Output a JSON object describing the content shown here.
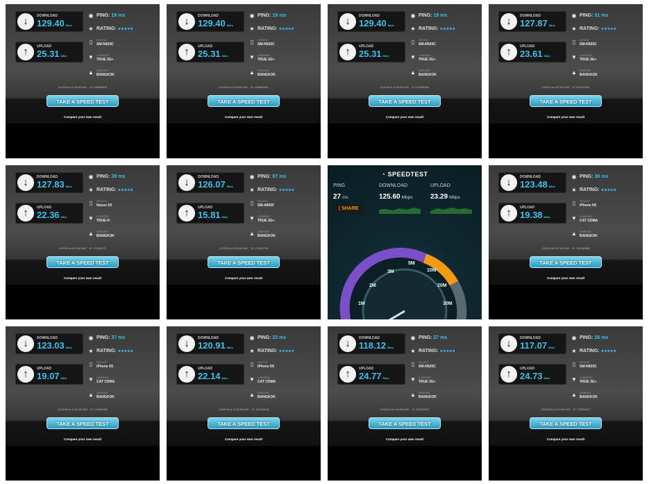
{
  "cards": [
    {
      "download": "129.40",
      "upload": "25.31",
      "ping": "19",
      "device": "SM-N920C",
      "carrier": "TRUE 3G+",
      "server": "BANGKOK",
      "date": "1/4/2016 at 11:06 AM GMT",
      "id": "1088604634"
    },
    {
      "download": "129.40",
      "upload": "25.31",
      "ping": "19",
      "device": "SM-N920C",
      "carrier": "TRUE 3G+",
      "server": "BANGKOK",
      "date": "1/4/2016 at 11:06 AM GMT",
      "id": "1088604634"
    },
    {
      "download": "129.40",
      "upload": "25.31",
      "ping": "19",
      "device": "SM-N920C",
      "carrier": "TRUE 3G+",
      "server": "BANGKOK",
      "date": "1/4/2016 at 11:06 AM GMT",
      "id": "1022069382"
    },
    {
      "download": "127.87",
      "upload": "23.61",
      "ping": "31",
      "device": "SM-N920C",
      "carrier": "TRUE 3G+",
      "server": "BANGKOK",
      "date": "2/4/2016 at 3:23 PM GMT",
      "id": "5740370967"
    },
    {
      "download": "127.83",
      "upload": "22.36",
      "ping": "39",
      "device": "Nexus 5X",
      "carrier": "TRUE-H",
      "server": "BANGKOK",
      "date": "2/2/2016 at 6:01 AM GMT",
      "id": "1714824772"
    },
    {
      "download": "126.07",
      "upload": "15.81",
      "ping": "87",
      "device": "SM-A800F",
      "carrier": "TRUE 3G+",
      "server": "BANGKOK",
      "date": "1/27/2016 at 8:08 AM GMT",
      "id": "1702047758"
    },
    null,
    {
      "download": "123.48",
      "upload": "19.38",
      "ping": "38",
      "device": "iPhone 6S",
      "carrier": "CAT CDMA",
      "server": "BANGKOK",
      "date": "2/3/2016 at 3:07 AM GMT",
      "id": "1021963698"
    },
    {
      "download": "123.03",
      "upload": "19.07",
      "ping": "37",
      "device": "iPhone 6S",
      "carrier": "CAT CDMA",
      "server": "BANGKOK",
      "date": "1/20/2016 at 11:32 AM GMT",
      "id": "1023560390"
    },
    {
      "download": "120.91",
      "upload": "22.14",
      "ping": "23",
      "device": "iPhone 6S",
      "carrier": "CAT CDMA",
      "server": "BANGKOK",
      "date": "1/18/2016 at 10:03 PM GMT",
      "id": "1811826148"
    },
    {
      "download": "118.12",
      "upload": "24.77",
      "ping": "27",
      "device": "SM-N920C",
      "carrier": "TRUE 3G+",
      "server": "BANGKOK",
      "date": "1/15/2016 at 1:40 PM GMT",
      "id": "1679153577"
    },
    {
      "download": "117.07",
      "upload": "24.73",
      "ping": "28",
      "device": "SM-N920C",
      "carrier": "TRUE 3G+",
      "server": "BANGKOK",
      "date": "1/20/2016 at 3:13 PM GMT",
      "id": "1759351577"
    }
  ],
  "labels": {
    "download": "DOWNLOAD",
    "upload": "UPLOAD",
    "unit": "Mb/s",
    "ping": "PING:",
    "ms": "ms",
    "rating": "RATING:",
    "stars": "★★★★★",
    "device": "DEVICE",
    "carrier": "CARRIER",
    "server": "SERVER",
    "take_test": "TAKE A SPEED TEST",
    "compare": "Compare your own result"
  },
  "ookla": {
    "logo": "SPEEDTEST",
    "ping_label": "PING",
    "ping_value": "27",
    "ping_unit": "ms",
    "download_label": "DOWNLOAD",
    "download_value": "125.60",
    "download_unit": "Mbps",
    "upload_label": "UPLOAD",
    "upload_value": "23.29",
    "upload_unit": "Mbps",
    "share": "SHARE",
    "gauge_ticks": [
      "1M",
      "2M",
      "3M",
      "5M",
      "10M",
      "20M",
      "30M"
    ]
  },
  "colors": {
    "accent": "#39c3ee",
    "button": "#2a9dc3",
    "ookla_orange": "#f39c12",
    "gauge_purple": "#7b4fc9"
  }
}
